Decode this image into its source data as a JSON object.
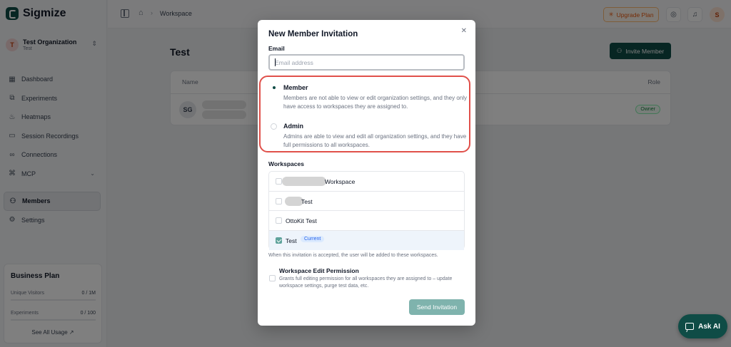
{
  "app": {
    "brand": "Sigmize",
    "org": {
      "initial": "T",
      "name": "Test Organization",
      "sub": "Test"
    },
    "nav": [
      {
        "label": "Dashboard",
        "icon": "dashboard-icon"
      },
      {
        "label": "Experiments",
        "icon": "experiments-icon"
      },
      {
        "label": "Heatmaps",
        "icon": "heatmaps-icon"
      },
      {
        "label": "Session Recordings",
        "icon": "video-icon"
      },
      {
        "label": "Connections",
        "icon": "connections-icon"
      },
      {
        "label": "MCP",
        "icon": "mcp-icon"
      },
      {
        "label": "Members",
        "icon": "members-icon",
        "active": true
      },
      {
        "label": "Settings",
        "icon": "gear-icon"
      }
    ],
    "plan": {
      "title": "Business Plan",
      "visitors_label": "Unique Visitors",
      "visitors_value": "0 / 1M",
      "experiments_label": "Experiments",
      "experiments_value": "0 / 100",
      "link": "See All Usage"
    },
    "topbar": {
      "crumb": "Workspace",
      "upgrade": "Upgrade Plan",
      "user_initial": "S"
    },
    "page": {
      "title": "Test",
      "invite_button": "Invite Member",
      "columns": [
        "Name",
        "Role"
      ],
      "row": {
        "initials": "SG",
        "role": "Owner"
      }
    },
    "ask_ai": "Ask AI"
  },
  "modal": {
    "title": "New Member Invitation",
    "email_label": "Email",
    "email_placeholder": "Email address",
    "roles": [
      {
        "name": "Member",
        "description": "Members are not able to view or edit organization settings, and they only have access to workspaces they are assigned to.",
        "selected": true
      },
      {
        "name": "Admin",
        "description": "Admins are able to view and edit all organization settings, and they have full permissions to all workspaces.",
        "selected": false
      }
    ],
    "workspaces_label": "Workspaces",
    "workspaces": [
      {
        "name": "Workspace",
        "checked": false
      },
      {
        "name": "Test",
        "checked": false
      },
      {
        "name": "OttoKit Test",
        "checked": false
      },
      {
        "name": "Test",
        "checked": true,
        "badge": "Current"
      }
    ],
    "workspaces_note": "When this invitation is accepted, the user will be added to these workspaces.",
    "permission": {
      "title": "Workspace Edit Permission",
      "description": "Grants full editing permission for all workspaces they are assigned to – update workspace settings, purge test data, etc."
    },
    "send_button": "Send Invitation"
  }
}
